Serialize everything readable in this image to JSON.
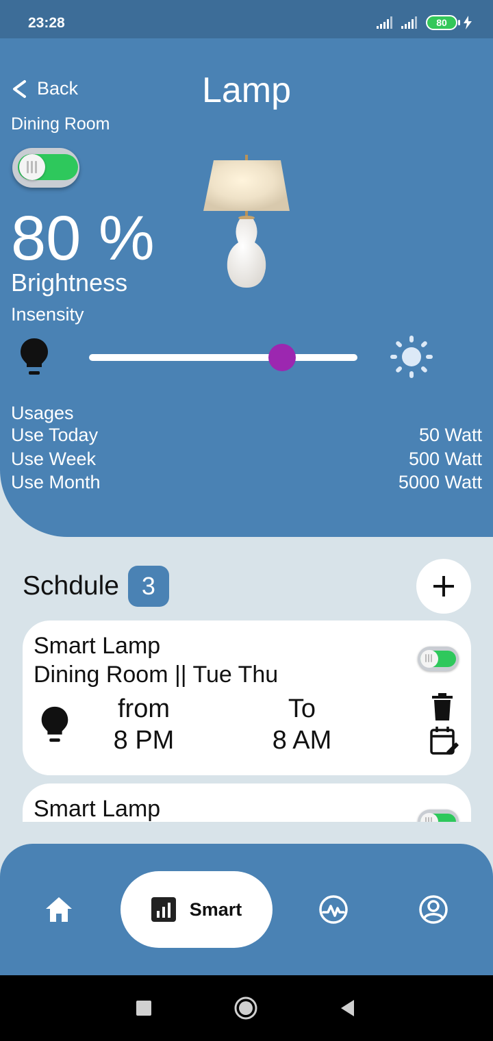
{
  "status_bar": {
    "time": "23:28",
    "battery": "80"
  },
  "header": {
    "back_label": "Back",
    "title": "Lamp",
    "room": "Dining Room"
  },
  "power": {
    "on": true
  },
  "brightness": {
    "value_text": "80 %",
    "label": "Brightness",
    "intensity_label": "Insensity",
    "slider_level": 0.72
  },
  "usages": {
    "title": "Usages",
    "rows": [
      {
        "label": "Use Today",
        "value": "50 Watt"
      },
      {
        "label": "Use Week",
        "value": "500 Watt"
      },
      {
        "label": "Use Month",
        "value": "5000 Watt"
      }
    ]
  },
  "schedule": {
    "title": "Schdule",
    "count": "3",
    "cards": [
      {
        "title": "Smart Lamp",
        "subtitle": "Dining Room || Tue Thu",
        "from_label": "from",
        "from_time": "8 PM",
        "to_label": "To",
        "to_time": "8 AM",
        "enabled": true
      },
      {
        "title": "Smart Lamp",
        "enabled": true
      }
    ]
  },
  "nav": {
    "smart_label": "Smart",
    "active": "smart"
  },
  "colors": {
    "primary": "#4a82b4",
    "status_bar": "#3d6d98",
    "accent_thumb": "#9c27b0",
    "toggle_on": "#2ec85c",
    "panel_bg": "#d8e3e9"
  },
  "icons": [
    "back-chevron-icon",
    "lamp-image",
    "bulb-icon",
    "sun-icon",
    "plus-icon",
    "trash-icon",
    "edit-calendar-icon",
    "home-icon",
    "bar-chart-icon",
    "activity-icon",
    "profile-icon"
  ]
}
